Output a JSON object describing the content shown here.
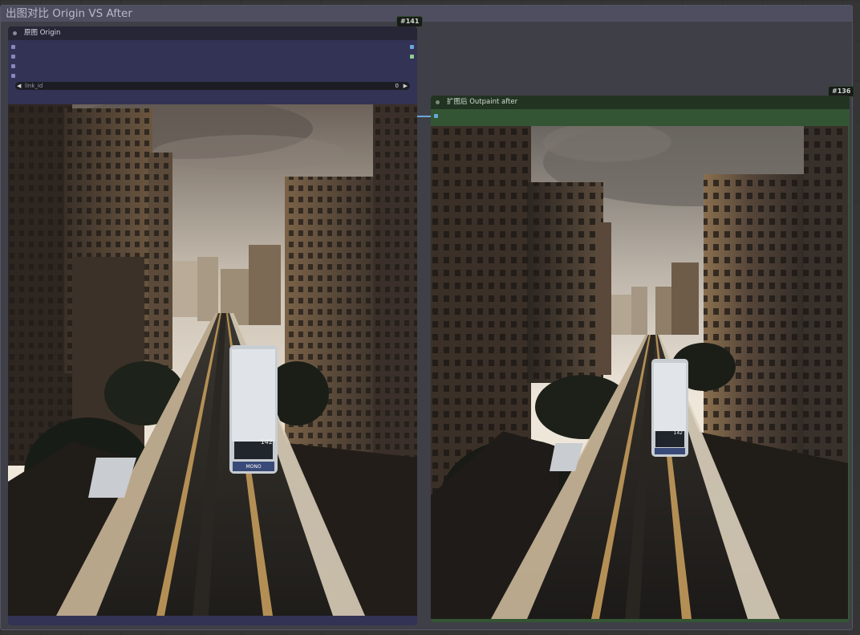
{
  "group": {
    "title": "出图对比 Origin VS After"
  },
  "node_origin": {
    "badge": "#141",
    "title": "原图 Origin",
    "widget": {
      "label": "link_id",
      "value": "0"
    }
  },
  "node_after": {
    "badge": "#136",
    "title": "扩图后 Outpaint after"
  },
  "image_origin": {
    "number": "142",
    "sign": "MONO"
  },
  "image_after": {
    "number": "142"
  },
  "icons": {
    "status_dot": "circle-dot",
    "decrement": "arrow-left",
    "increment": "arrow-right"
  },
  "colors": {
    "canvas": "#353535",
    "group_body": "#3f3f47",
    "group_header": "#4e4e60",
    "origin_body": "#333355",
    "origin_header": "#262636",
    "after_body": "#335533",
    "after_header": "#223322",
    "link": "#6aa8d8"
  }
}
